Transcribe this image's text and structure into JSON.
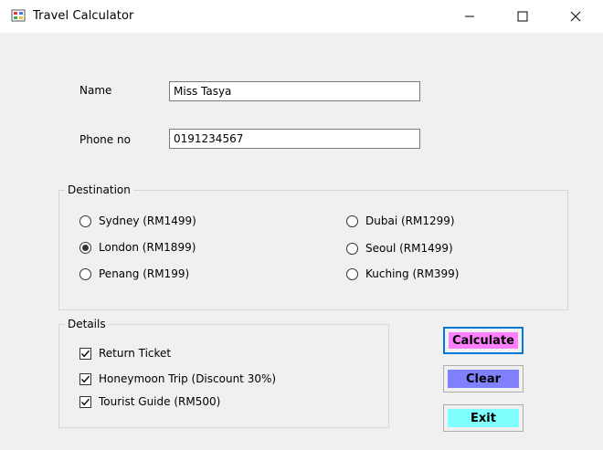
{
  "window": {
    "title": "Travel Calculator"
  },
  "form": {
    "name_label": "Name",
    "name_value": "Miss Tasya",
    "phone_label": "Phone no",
    "phone_value": "0191234567"
  },
  "destination": {
    "legend": "Destination",
    "options": [
      {
        "label": "Sydney (RM1499)",
        "selected": false
      },
      {
        "label": "London (RM1899)",
        "selected": true
      },
      {
        "label": "Penang (RM199)",
        "selected": false
      },
      {
        "label": "Dubai (RM1299)",
        "selected": false
      },
      {
        "label": "Seoul (RM1499)",
        "selected": false
      },
      {
        "label": "Kuching (RM399)",
        "selected": false
      }
    ]
  },
  "details": {
    "legend": "Details",
    "options": [
      {
        "label": "Return Ticket",
        "checked": true
      },
      {
        "label": "Honeymoon Trip (Discount 30%)",
        "checked": true
      },
      {
        "label": "Tourist Guide (RM500)",
        "checked": true
      }
    ]
  },
  "buttons": {
    "calculate": "Calculate",
    "clear": "Clear",
    "exit": "Exit"
  },
  "colors": {
    "calculate": "#ff80ff",
    "clear": "#8080ff",
    "exit": "#80ffff",
    "focus_border": "#0078d7"
  }
}
